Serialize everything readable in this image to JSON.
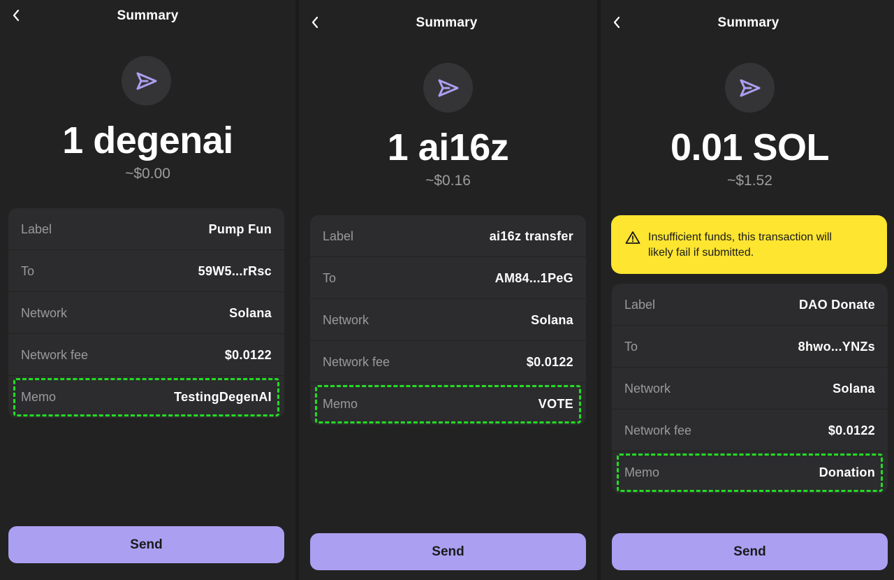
{
  "screens": [
    {
      "title": "Summary",
      "amount": "1 degenai",
      "fiat": "~$0.00",
      "rows": [
        {
          "label": "Label",
          "value": "Pump Fun"
        },
        {
          "label": "To",
          "value": "59W5...rRsc"
        },
        {
          "label": "Network",
          "value": "Solana"
        },
        {
          "label": "Network fee",
          "value": "$0.0122"
        },
        {
          "label": "Memo",
          "value": "TestingDegenAI"
        }
      ],
      "send_label": "Send"
    },
    {
      "title": "Summary",
      "amount": "1 ai16z",
      "fiat": "~$0.16",
      "rows": [
        {
          "label": "Label",
          "value": "ai16z transfer"
        },
        {
          "label": "To",
          "value": "AM84...1PeG"
        },
        {
          "label": "Network",
          "value": "Solana"
        },
        {
          "label": "Network fee",
          "value": "$0.0122"
        },
        {
          "label": "Memo",
          "value": "VOTE"
        }
      ],
      "send_label": "Send"
    },
    {
      "title": "Summary",
      "amount": "0.01 SOL",
      "fiat": "~$1.52",
      "warning": "Insufficient funds, this transaction will likely fail if submitted.",
      "rows": [
        {
          "label": "Label",
          "value": "DAO Donate"
        },
        {
          "label": "To",
          "value": "8hwo...YNZs"
        },
        {
          "label": "Network",
          "value": "Solana"
        },
        {
          "label": "Network fee",
          "value": "$0.0122"
        },
        {
          "label": "Memo",
          "value": "Donation"
        }
      ],
      "send_label": "Send"
    }
  ],
  "colors": {
    "background": "#222222",
    "card": "#2c2c2e",
    "accent": "#ab9ff2",
    "warning": "#fde530",
    "highlight": "#22dd22"
  },
  "icons": {
    "back": "chevron-left-icon",
    "send": "send-arrow-icon",
    "warning": "warning-triangle-icon"
  }
}
